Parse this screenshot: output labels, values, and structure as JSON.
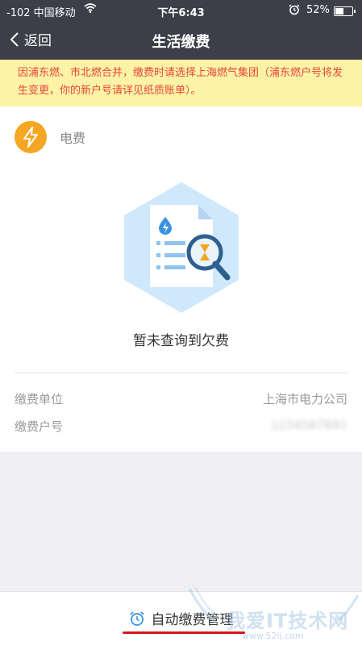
{
  "status_bar": {
    "carrier": "-102 中国移动",
    "time": "下午6:43",
    "battery": "52%",
    "battery_level": 0.52
  },
  "nav": {
    "back_label": "返回",
    "title": "生活缴费"
  },
  "notice": {
    "text": "因浦东燃、市北燃合并，缴费时请选择上海燃气集团（浦东燃户号将发生变更，你的新户号请详见纸质账单）。"
  },
  "bill": {
    "type_label": "电费",
    "empty_message": "暂未查询到欠费",
    "unit_label": "缴费单位",
    "unit_value": "上海市电力公司",
    "account_label": "缴费户号",
    "account_value": "1234567891"
  },
  "footer": {
    "auto_pay_label": "自动缴费管理"
  },
  "watermark": {
    "text": "我爱IT技术网",
    "url": "www.52ij.com"
  },
  "colors": {
    "header_bg": "#3c3f48",
    "notice_bg": "#fdf3a6",
    "notice_text": "#e5463a",
    "accent_orange": "#f5a623",
    "illustration_bg": "#cfe8fb",
    "underline_red": "#d0181d"
  }
}
